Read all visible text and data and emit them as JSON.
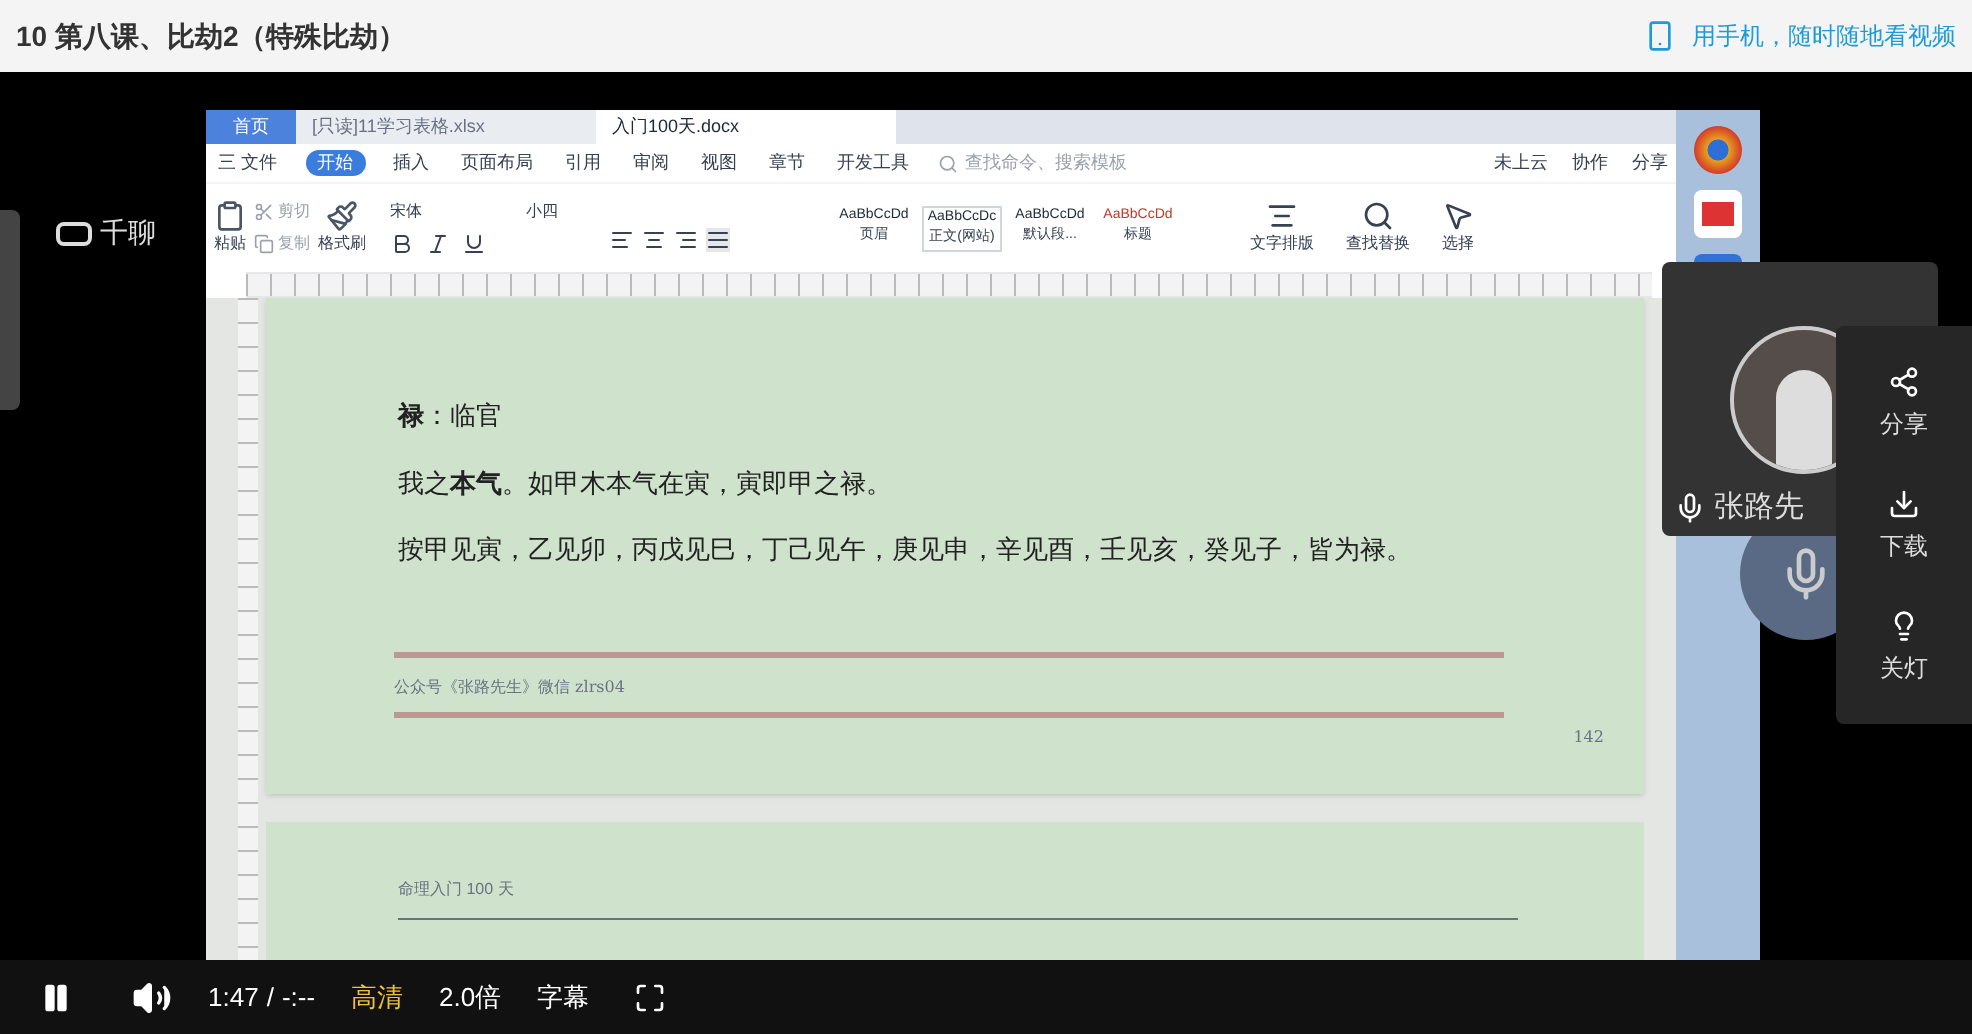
{
  "header": {
    "title": "10 第八课、比劫2（特殊比劫）",
    "mobile_link": "用手机，随时随地看视频"
  },
  "player": {
    "brand": "千聊",
    "recording": {
      "app_tabs": [
        {
          "label": "首页",
          "selected": false
        },
        {
          "label": "[只读]11学习表格.xlsx",
          "selected": false
        },
        {
          "label": "入门100天.docx",
          "selected": true
        }
      ],
      "menu": [
        {
          "label": "三 文件",
          "selected": false
        },
        {
          "label": "开始",
          "selected": true
        },
        {
          "label": "插入",
          "selected": false
        },
        {
          "label": "页面布局",
          "selected": false
        },
        {
          "label": "引用",
          "selected": false
        },
        {
          "label": "审阅",
          "selected": false
        },
        {
          "label": "视图",
          "selected": false
        },
        {
          "label": "章节",
          "selected": false
        },
        {
          "label": "开发工具",
          "selected": false
        }
      ],
      "search_placeholder": "查找命令、搜索模板",
      "menu_right": [
        "未上云",
        "协作",
        "分享"
      ],
      "clipboard": [
        "粘贴",
        "剪切",
        "复制",
        "格式刷"
      ],
      "font": "宋体",
      "size": "小四",
      "styles": [
        {
          "sample": "AaBbCcDd",
          "label": "页眉"
        },
        {
          "sample": "AaBbCcDc",
          "label": "正文(网站)"
        },
        {
          "sample": "AaBbCcDd",
          "label": "默认段..."
        },
        {
          "sample": "AaBbCcDd",
          "label": "标题"
        }
      ],
      "tools": [
        "文字排版",
        "查找替换",
        "选择"
      ],
      "page": {
        "lines": [
          "**禄**：临官",
          "我之**本气**。如甲木本气在寅，寅即甲之禄。",
          "按甲见寅，乙见卯，丙戊见巳，丁己见午，庚见申，辛见酉，壬见亥，癸见子，皆为禄。"
        ],
        "footer": "公众号《张路先生》微信 zlrs04",
        "page_number": "142"
      },
      "next_page_header": "命理入门 100 天"
    },
    "speaker": {
      "name": "张路先"
    },
    "side_menu": [
      {
        "kind": "share",
        "label": "分享"
      },
      {
        "kind": "download",
        "label": "下载"
      },
      {
        "kind": "light",
        "label": "关灯"
      }
    ],
    "controls": {
      "playing": true,
      "time": "1:47",
      "separator": "/",
      "duration": "-:--",
      "quality": "高清",
      "speed": "2.0倍",
      "subtitles": "字幕"
    }
  }
}
